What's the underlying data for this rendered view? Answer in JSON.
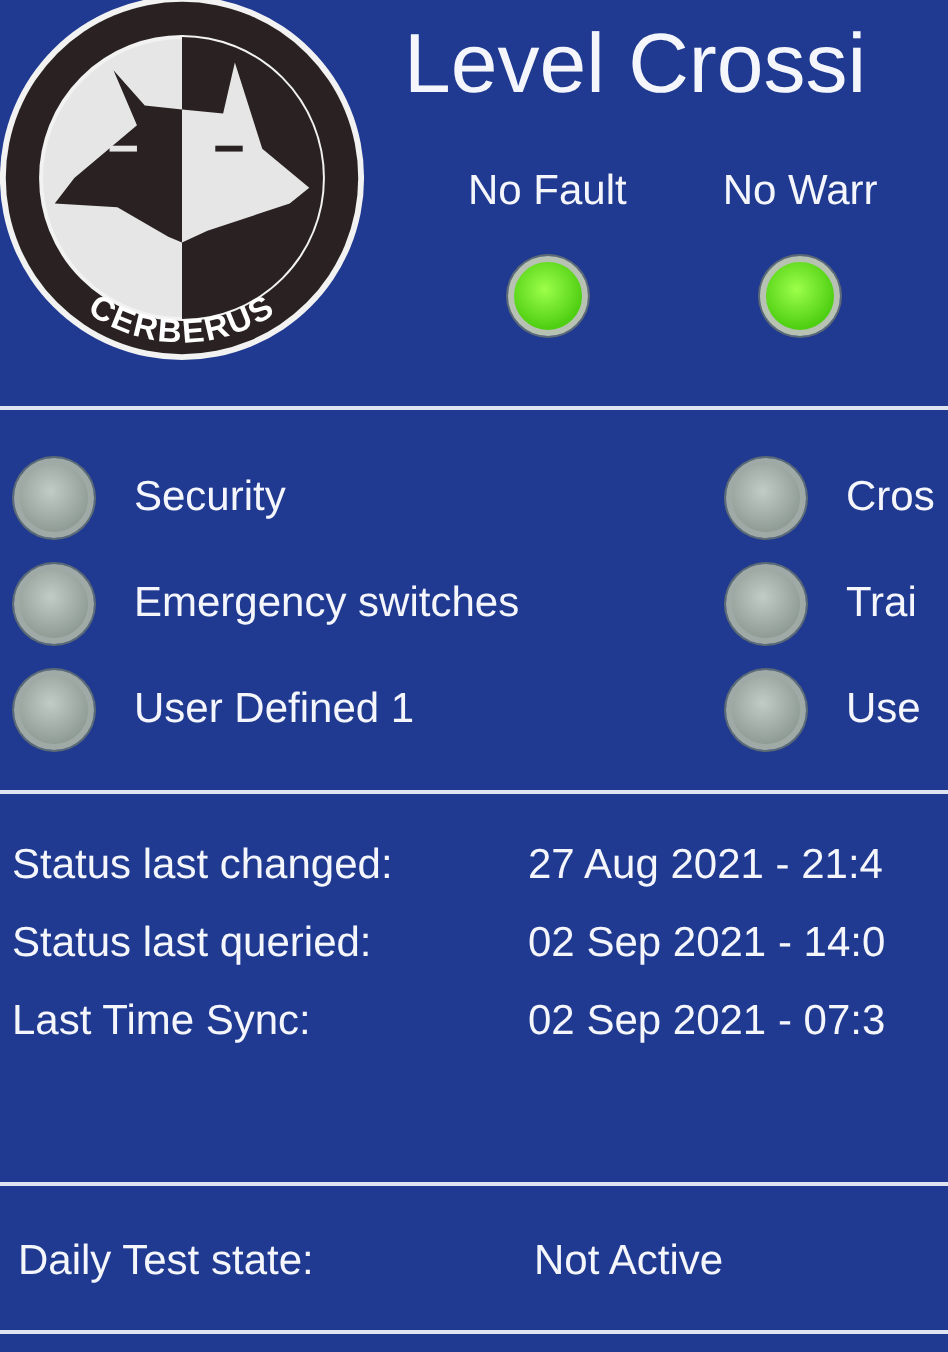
{
  "logo": {
    "text": "CERBERUS"
  },
  "title": "Level Crossi",
  "status_lamps": [
    {
      "label": "No Fault",
      "lit": true
    },
    {
      "label": "No Warr",
      "lit": true
    }
  ],
  "indicators": [
    {
      "label": "Security",
      "lit": false
    },
    {
      "label": "Cros",
      "lit": false
    },
    {
      "label": "Emergency switches",
      "lit": false
    },
    {
      "label": "Trai",
      "lit": false
    },
    {
      "label": "User Defined 1",
      "lit": false
    },
    {
      "label": "Use",
      "lit": false
    }
  ],
  "info": [
    {
      "label": "Status last changed:",
      "value": "27 Aug 2021 - 21:4"
    },
    {
      "label": "Status last queried:",
      "value": "02 Sep 2021 - 14:0"
    },
    {
      "label": "Last Time Sync:",
      "value": "02 Sep 2021 - 07:3"
    }
  ],
  "daily_test": {
    "label": "Daily Test state:",
    "value": "Not Active"
  }
}
